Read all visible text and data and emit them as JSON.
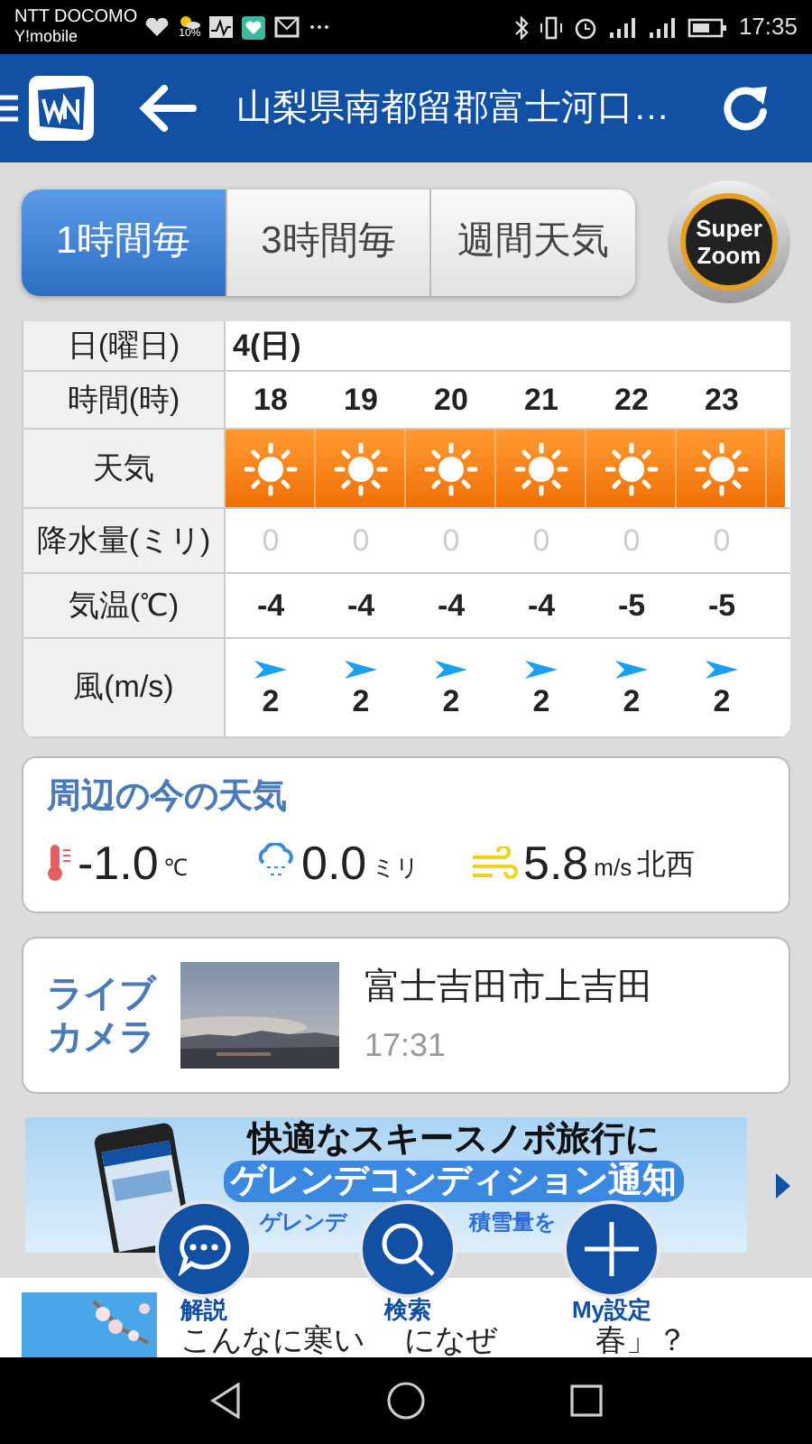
{
  "status_bar": {
    "carriers": [
      "NTT DOCOMO",
      "Y!mobile"
    ],
    "weather_percent": "10%",
    "time": "17:35"
  },
  "header": {
    "title": "山梨県南都留郡富士河口…"
  },
  "tabs": [
    {
      "label": "1時間毎",
      "selected": true
    },
    {
      "label": "3時間毎",
      "selected": false
    },
    {
      "label": "週間天気",
      "selected": false
    }
  ],
  "super_zoom": [
    "Super",
    "Zoom"
  ],
  "table": {
    "rows": [
      {
        "kind": "date",
        "label": "日(曜日)",
        "cells": [
          "4(日)"
        ]
      },
      {
        "kind": "hour",
        "label": "時間(時)",
        "cells": [
          "18",
          "19",
          "20",
          "21",
          "22",
          "23"
        ]
      },
      {
        "kind": "weather",
        "label": "天気",
        "cells": [
          {
            "kind": "sunny"
          },
          {
            "kind": "sunny"
          },
          {
            "kind": "sunny"
          },
          {
            "kind": "sunny"
          },
          {
            "kind": "sunny"
          },
          {
            "kind": "sunny"
          }
        ]
      },
      {
        "kind": "precip",
        "label": "降水量(ミリ)",
        "cells": [
          "0",
          "0",
          "0",
          "0",
          "0",
          "0"
        ]
      },
      {
        "kind": "temp",
        "label": "気温(℃)",
        "cells": [
          "-4",
          "-4",
          "-4",
          "-4",
          "-5",
          "-5"
        ]
      },
      {
        "kind": "wind",
        "label": "風(m/s)",
        "cells": [
          {
            "kind": "east",
            "speed": "2"
          },
          {
            "kind": "east",
            "speed": "2"
          },
          {
            "kind": "east",
            "speed": "2"
          },
          {
            "kind": "east",
            "speed": "2"
          },
          {
            "kind": "east",
            "speed": "2"
          },
          {
            "kind": "east",
            "speed": "2"
          }
        ]
      }
    ]
  },
  "current": {
    "title": "周辺の今の天気",
    "items": [
      {
        "kind": "temperature",
        "value": "-1.0",
        "unit": "℃"
      },
      {
        "kind": "rain",
        "value": "0.0",
        "unit": "ミリ"
      },
      {
        "kind": "wind",
        "value": "5.8",
        "unit": "m/s",
        "direction": "北西"
      }
    ]
  },
  "live_camera": {
    "label": [
      "ライブ",
      "カメラ"
    ],
    "place": "富士吉田市上吉田",
    "time": "17:31"
  },
  "banner": {
    "line_1": "快適なスキースノボ旅行に",
    "line_2": "ゲレンデコンディション通知",
    "line_3": [
      "ゲレンデ",
      "積雪量を"
    ]
  },
  "fabs": [
    {
      "kind": "comment",
      "label": "解説"
    },
    {
      "kind": "search",
      "label": "検索"
    },
    {
      "kind": "plus",
      "label": "My設定"
    }
  ],
  "article": {
    "title_parts": [
      "こんなに寒い",
      "になぜ",
      "春」？"
    ]
  }
}
